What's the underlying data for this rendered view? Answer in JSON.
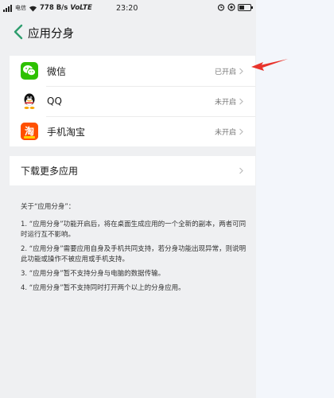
{
  "status_bar": {
    "signal_text": "电信",
    "speed": "778 B/s",
    "network": "VoLTE",
    "time": "23:20",
    "battery_level_fraction": 0.45
  },
  "header": {
    "back_icon": "chevron-left-icon",
    "title": "应用分身"
  },
  "apps": [
    {
      "name": "微信",
      "status": "已开启",
      "icon": "wechat-icon",
      "icon_color": "#2dc100"
    },
    {
      "name": "QQ",
      "status": "未开启",
      "icon": "qq-icon",
      "icon_color": "#000000"
    },
    {
      "name": "手机淘宝",
      "status": "未开启",
      "icon": "taobao-icon",
      "icon_color": "#ff5000"
    }
  ],
  "more": {
    "label": "下载更多应用"
  },
  "notes": {
    "title": "关于“应用分身”：",
    "items": [
      "1. “应用分身”功能开启后，将在桌面生成应用的一个全新的副本，两者可同时运行互不影响。",
      "2. “应用分身”需要应用自身及手机共同支持，若分身功能出现异常，则说明此功能或操作不被应用或手机支持。",
      "3. “应用分身”暂不支持分身与电脑的数据传输。",
      "4. “应用分身”暂不支持同时打开两个以上的分身应用。"
    ]
  },
  "colors": {
    "accent_green": "#2e9d6e",
    "annotation_red": "#e8332b",
    "page_background": "#eff0f2"
  }
}
